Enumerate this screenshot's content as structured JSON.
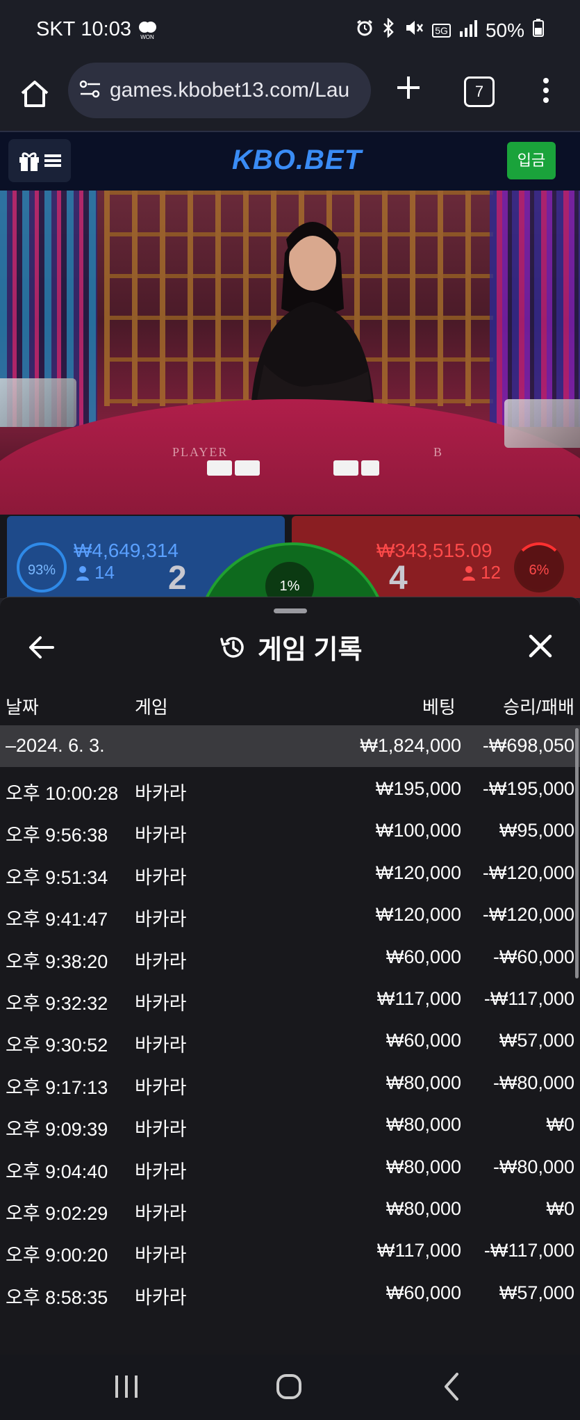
{
  "status_bar": {
    "carrier": "SKT",
    "time": "10:03",
    "battery": "50%",
    "network": "5G"
  },
  "browser": {
    "url": "games.kbobet13.com/Lau",
    "tab_count": "7"
  },
  "site": {
    "logo": "KBO.BET",
    "deposit_label": "입금"
  },
  "video": {
    "felt_player": "PLAYER",
    "felt_banker": "B"
  },
  "bet_panel": {
    "player_pct": "93%",
    "player_amount": "₩4,649,314",
    "player_users": "14",
    "player_score": "2",
    "tie_pct": "1%",
    "banker_amount": "₩343,515.09",
    "banker_users": "12",
    "banker_score": "4",
    "banker_pct": "6%"
  },
  "history": {
    "title": "게임 기록",
    "columns": {
      "date": "날짜",
      "game": "게임",
      "bet": "베팅",
      "result": "승리/패배"
    },
    "summary": {
      "date": "–2024. 6. 3.",
      "bet": "₩1,824,000",
      "result": "-₩698,050"
    },
    "rows": [
      {
        "time": "오후 10:00:28",
        "game": "바카라",
        "bet": "₩195,000",
        "result": "-₩195,000"
      },
      {
        "time": "오후 9:56:38",
        "game": "바카라",
        "bet": "₩100,000",
        "result": "₩95,000"
      },
      {
        "time": "오후 9:51:34",
        "game": "바카라",
        "bet": "₩120,000",
        "result": "-₩120,000"
      },
      {
        "time": "오후 9:41:47",
        "game": "바카라",
        "bet": "₩120,000",
        "result": "-₩120,000"
      },
      {
        "time": "오후 9:38:20",
        "game": "바카라",
        "bet": "₩60,000",
        "result": "-₩60,000"
      },
      {
        "time": "오후 9:32:32",
        "game": "바카라",
        "bet": "₩117,000",
        "result": "-₩117,000"
      },
      {
        "time": "오후 9:30:52",
        "game": "바카라",
        "bet": "₩60,000",
        "result": "₩57,000"
      },
      {
        "time": "오후 9:17:13",
        "game": "바카라",
        "bet": "₩80,000",
        "result": "-₩80,000"
      },
      {
        "time": "오후 9:09:39",
        "game": "바카라",
        "bet": "₩80,000",
        "result": "₩0"
      },
      {
        "time": "오후 9:04:40",
        "game": "바카라",
        "bet": "₩80,000",
        "result": "-₩80,000"
      },
      {
        "time": "오후 9:02:29",
        "game": "바카라",
        "bet": "₩80,000",
        "result": "₩0"
      },
      {
        "time": "오후 9:00:20",
        "game": "바카라",
        "bet": "₩117,000",
        "result": "-₩117,000"
      },
      {
        "time": "오후 8:58:35",
        "game": "바카라",
        "bet": "₩60,000",
        "result": "₩57,000"
      }
    ]
  }
}
